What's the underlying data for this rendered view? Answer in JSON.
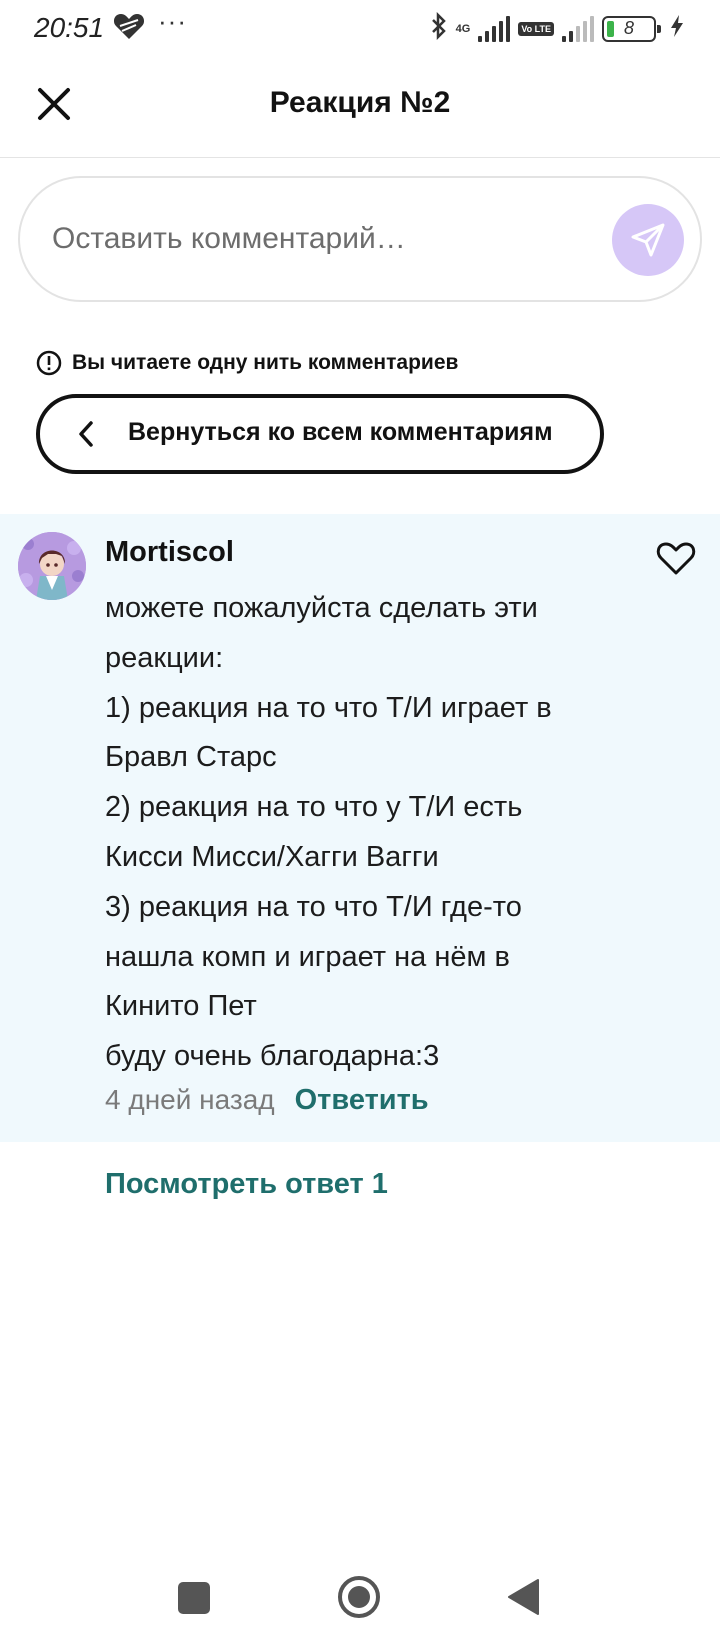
{
  "status_bar": {
    "time": "20:51",
    "dots": "···",
    "network_label": "4G",
    "volte_label": "Vo LTE",
    "battery_level": "8",
    "icons": [
      "heart-icon",
      "bluetooth-icon",
      "signal-icon",
      "battery-icon",
      "charging-icon"
    ]
  },
  "header": {
    "title": "Реакция №2",
    "close_icon": "close-icon"
  },
  "comment_box": {
    "placeholder": "Оставить комментарий…",
    "send_icon": "send-icon"
  },
  "thread": {
    "notice": "Вы читаете одну нить комментариев",
    "back_label": "Вернуться ко всем комментариям"
  },
  "comment": {
    "author": "Mortiscol",
    "lines": [
      "можете пожалуйста сделать эти",
      "реакции:",
      "1) реакция на то что Т/И играет в",
      "Бравл Старс",
      "2) реакция на то что у Т/И есть",
      "Кисси Мисси/Хагги Вагги",
      "3) реакция на то что Т/И где-то",
      "нашла комп и играет на нём в",
      "Кинито Пет",
      "буду очень благодарна:3"
    ],
    "time": "4 дней назад",
    "reply_label": "Ответить"
  },
  "replies": {
    "view_label": "Посмотреть ответ 1"
  },
  "colors": {
    "accent_teal": "#1f6e6c",
    "send_button": "#d6c7f7",
    "card_bg": "#f0f9fd"
  }
}
